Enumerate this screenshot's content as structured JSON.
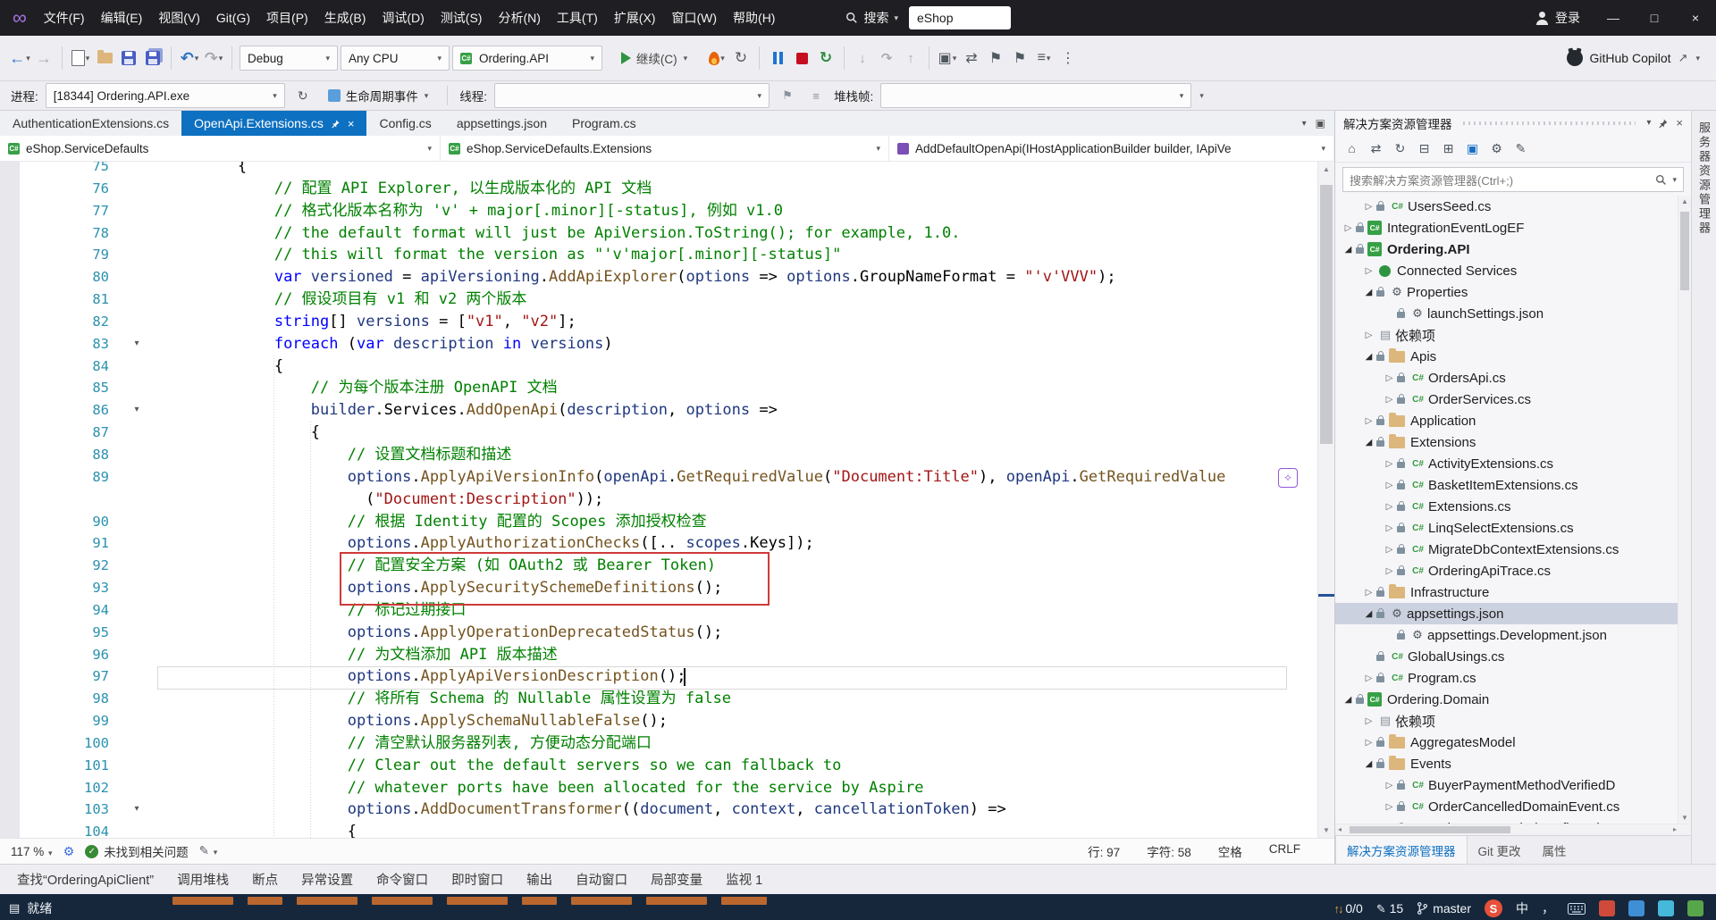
{
  "palette": {
    "accent_blue": "#0E70C0",
    "titlebar_bg": "#1F1F23",
    "toolbar_bg": "#EEEEF2",
    "statusbar_bg": "#16273C",
    "comment_green": "#008000",
    "keyword_blue": "#0000FF",
    "string_red": "#A31515",
    "method_brown": "#74531F",
    "identifier_blue": "#1F377F",
    "line_number_teal": "#2B91AF",
    "annotation_red": "#CF3A3A",
    "selection_gray": "#CCD1DF",
    "orange_marker": "#B9672E"
  },
  "icons": {
    "infinity": "∞",
    "chevron_down": "▾",
    "back": "←",
    "forward": "→",
    "undo": "↶",
    "redo": "↷",
    "refresh": "↻",
    "flag": "⚑",
    "min": "—",
    "max": "□",
    "close": "×",
    "check": "✓",
    "pencil": "✎",
    "up": "↑",
    "down": "↓",
    "gear": "⚙",
    "home": "⌂",
    "swap": "⇄",
    "collapse_all": "⊟",
    "show_all": "⊞",
    "grid": "▣",
    "deps": "▤",
    "dots": "⋮",
    "arrow_out": "↗",
    "tri_open": "◢",
    "tri_closed": "▷",
    "up_small": "▲",
    "down_small": "▼",
    "left_small": "◂",
    "right_small": "▸",
    "lines": "▤",
    "sparkle": "✧",
    "menu": "≡",
    "fold": "▾",
    "braces": "{}"
  },
  "titlebar": {
    "menus": [
      "文件(F)",
      "编辑(E)",
      "视图(V)",
      "Git(G)",
      "项目(P)",
      "生成(B)",
      "调试(D)",
      "测试(S)",
      "分析(N)",
      "工具(T)",
      "扩展(X)",
      "窗口(W)",
      "帮助(H)"
    ],
    "search_label": "搜索",
    "search_value": "eShop",
    "signin_label": "登录"
  },
  "toolbar": {
    "config": "Debug",
    "platform": "Any CPU",
    "profile": "Ordering.API",
    "continue_label": "继续(C)",
    "copilot_label": "GitHub Copilot"
  },
  "debugbar": {
    "process_label": "进程:",
    "process_value": "[18344] Ordering.API.exe",
    "lifecycle_label": "生命周期事件",
    "thread_label": "线程:",
    "stackframe_label": "堆栈帧:"
  },
  "tabbar": {
    "tabs": [
      {
        "label": "AuthenticationExtensions.cs",
        "active": false
      },
      {
        "label": "OpenApi.Extensions.cs",
        "active": true
      },
      {
        "label": "Config.cs",
        "active": false
      },
      {
        "label": "appsettings.json",
        "active": false
      },
      {
        "label": "Program.cs",
        "active": false
      }
    ]
  },
  "navbar": {
    "scopes": [
      {
        "label": "eShop.ServiceDefaults",
        "icon": "project"
      },
      {
        "label": "eShop.ServiceDefaults.Extensions",
        "icon": "class"
      },
      {
        "label": "AddDefaultOpenApi(IHostApplicationBuilder builder, IApiVe",
        "icon": "method"
      }
    ]
  },
  "editor": {
    "current_line": "97",
    "red_box_from": "92",
    "red_box_to": "93",
    "lines": [
      {
        "n": "75",
        "s": [
          [
            "p",
            "        {"
          ]
        ]
      },
      {
        "n": "76",
        "s": [
          [
            "p",
            "            "
          ],
          [
            "c",
            "// 配置 API Explorer, 以生成版本化的 API 文档"
          ]
        ]
      },
      {
        "n": "77",
        "s": [
          [
            "p",
            "            "
          ],
          [
            "c",
            "// 格式化版本名称为 'v' + major[.minor][-status], 例如 v1.0"
          ]
        ]
      },
      {
        "n": "78",
        "s": [
          [
            "p",
            "            "
          ],
          [
            "c",
            "// the default format will just be ApiVersion.ToString(); for example, 1.0."
          ]
        ]
      },
      {
        "n": "79",
        "s": [
          [
            "p",
            "            "
          ],
          [
            "c",
            "// this will format the version as \"'v'major[.minor][-status]\""
          ]
        ]
      },
      {
        "n": "80",
        "s": [
          [
            "p",
            "            "
          ],
          [
            "k",
            "var"
          ],
          [
            "p",
            " "
          ],
          [
            "v",
            "versioned"
          ],
          [
            "p",
            " = "
          ],
          [
            "v",
            "apiVersioning"
          ],
          [
            "p",
            "."
          ],
          [
            "m",
            "AddApiExplorer"
          ],
          [
            "p",
            "("
          ],
          [
            "v",
            "options"
          ],
          [
            "p",
            " => "
          ],
          [
            "v",
            "options"
          ],
          [
            "p",
            ".GroupNameFormat = "
          ],
          [
            "s",
            "\"'v'VVV\""
          ],
          [
            "p",
            ");"
          ]
        ]
      },
      {
        "n": "81",
        "s": [
          [
            "p",
            "            "
          ],
          [
            "c",
            "// 假设项目有 v1 和 v2 两个版本"
          ]
        ]
      },
      {
        "n": "82",
        "s": [
          [
            "p",
            "            "
          ],
          [
            "k",
            "string"
          ],
          [
            "p",
            "[] "
          ],
          [
            "v",
            "versions"
          ],
          [
            "p",
            " = ["
          ],
          [
            "s",
            "\"v1\""
          ],
          [
            "p",
            ", "
          ],
          [
            "s",
            "\"v2\""
          ],
          [
            "p",
            "];"
          ]
        ]
      },
      {
        "n": "83",
        "f": 1,
        "s": [
          [
            "p",
            "            "
          ],
          [
            "k",
            "foreach"
          ],
          [
            "p",
            " ("
          ],
          [
            "k",
            "var"
          ],
          [
            "p",
            " "
          ],
          [
            "v",
            "description"
          ],
          [
            "p",
            " "
          ],
          [
            "k",
            "in"
          ],
          [
            "p",
            " "
          ],
          [
            "v",
            "versions"
          ],
          [
            "p",
            ")"
          ]
        ]
      },
      {
        "n": "84",
        "s": [
          [
            "p",
            "            {"
          ]
        ]
      },
      {
        "n": "85",
        "s": [
          [
            "p",
            "                "
          ],
          [
            "c",
            "// 为每个版本注册 OpenAPI 文档"
          ]
        ]
      },
      {
        "n": "86",
        "f": 1,
        "s": [
          [
            "p",
            "                "
          ],
          [
            "v",
            "builder"
          ],
          [
            "p",
            ".Services."
          ],
          [
            "m",
            "AddOpenApi"
          ],
          [
            "p",
            "("
          ],
          [
            "v",
            "description"
          ],
          [
            "p",
            ", "
          ],
          [
            "v",
            "options"
          ],
          [
            "p",
            " =>"
          ]
        ]
      },
      {
        "n": "87",
        "s": [
          [
            "p",
            "                {"
          ]
        ]
      },
      {
        "n": "88",
        "s": [
          [
            "p",
            "                    "
          ],
          [
            "c",
            "// 设置文档标题和描述"
          ]
        ]
      },
      {
        "n": "89",
        "s": [
          [
            "p",
            "                    "
          ],
          [
            "v",
            "options"
          ],
          [
            "p",
            "."
          ],
          [
            "m",
            "ApplyApiVersionInfo"
          ],
          [
            "p",
            "("
          ],
          [
            "v",
            "openApi"
          ],
          [
            "p",
            "."
          ],
          [
            "m",
            "GetRequiredValue"
          ],
          [
            "p",
            "("
          ],
          [
            "s",
            "\"Document:Title\""
          ],
          [
            "p",
            "), "
          ],
          [
            "v",
            "openApi"
          ],
          [
            "p",
            "."
          ],
          [
            "m",
            "GetRequiredValue"
          ]
        ]
      },
      {
        "n": "",
        "s": [
          [
            "p",
            "                      ("
          ],
          [
            "s",
            "\"Document:Description\""
          ],
          [
            "p",
            "));"
          ]
        ]
      },
      {
        "n": "90",
        "s": [
          [
            "p",
            "                    "
          ],
          [
            "c",
            "// 根据 Identity 配置的 Scopes 添加授权检查"
          ]
        ]
      },
      {
        "n": "91",
        "s": [
          [
            "p",
            "                    "
          ],
          [
            "v",
            "options"
          ],
          [
            "p",
            "."
          ],
          [
            "m",
            "ApplyAuthorizationChecks"
          ],
          [
            "p",
            "([.. "
          ],
          [
            "v",
            "scopes"
          ],
          [
            "p",
            ".Keys]);"
          ]
        ]
      },
      {
        "n": "92",
        "s": [
          [
            "p",
            "                    "
          ],
          [
            "c",
            "// 配置安全方案 (如 OAuth2 或 Bearer Token)"
          ]
        ]
      },
      {
        "n": "93",
        "s": [
          [
            "p",
            "                    "
          ],
          [
            "v",
            "options"
          ],
          [
            "p",
            "."
          ],
          [
            "m",
            "ApplySecuritySchemeDefinitions"
          ],
          [
            "p",
            "();"
          ]
        ]
      },
      {
        "n": "94",
        "s": [
          [
            "p",
            "                    "
          ],
          [
            "c",
            "// 标记过期接口"
          ]
        ]
      },
      {
        "n": "95",
        "s": [
          [
            "p",
            "                    "
          ],
          [
            "v",
            "options"
          ],
          [
            "p",
            "."
          ],
          [
            "m",
            "ApplyOperationDeprecatedStatus"
          ],
          [
            "p",
            "();"
          ]
        ]
      },
      {
        "n": "96",
        "s": [
          [
            "p",
            "                    "
          ],
          [
            "c",
            "// 为文档添加 API 版本描述"
          ]
        ]
      },
      {
        "n": "97",
        "s": [
          [
            "p",
            "                    "
          ],
          [
            "v",
            "options"
          ],
          [
            "p",
            "."
          ],
          [
            "m",
            "ApplyApiVersionDescription"
          ],
          [
            "p",
            "();"
          ]
        ]
      },
      {
        "n": "98",
        "s": [
          [
            "p",
            "                    "
          ],
          [
            "c",
            "// 将所有 Schema 的 Nullable 属性设置为 false"
          ]
        ]
      },
      {
        "n": "99",
        "s": [
          [
            "p",
            "                    "
          ],
          [
            "v",
            "options"
          ],
          [
            "p",
            "."
          ],
          [
            "m",
            "ApplySchemaNullableFalse"
          ],
          [
            "p",
            "();"
          ]
        ]
      },
      {
        "n": "100",
        "s": [
          [
            "p",
            "                    "
          ],
          [
            "c",
            "// 清空默认服务器列表, 方便动态分配端口"
          ]
        ]
      },
      {
        "n": "101",
        "s": [
          [
            "p",
            "                    "
          ],
          [
            "c",
            "// Clear out the default servers so we can fallback to"
          ]
        ]
      },
      {
        "n": "102",
        "s": [
          [
            "p",
            "                    "
          ],
          [
            "c",
            "// whatever ports have been allocated for the service by Aspire"
          ]
        ]
      },
      {
        "n": "103",
        "f": 1,
        "s": [
          [
            "p",
            "                    "
          ],
          [
            "v",
            "options"
          ],
          [
            "p",
            "."
          ],
          [
            "m",
            "AddDocumentTransformer"
          ],
          [
            "p",
            "(("
          ],
          [
            "v",
            "document"
          ],
          [
            "p",
            ", "
          ],
          [
            "v",
            "context"
          ],
          [
            "p",
            ", "
          ],
          [
            "v",
            "cancellationToken"
          ],
          [
            "p",
            ") =>"
          ]
        ]
      },
      {
        "n": "104",
        "s": [
          [
            "p",
            "                    {"
          ]
        ]
      }
    ]
  },
  "editor_status": {
    "zoom": "117 %",
    "health": "未找到相关问题",
    "line": "行: 97",
    "column": "字符: 58",
    "whitespace": "空格",
    "line_ending": "CRLF"
  },
  "solution_explorer": {
    "title": "解决方案资源管理器",
    "search_placeholder": "搜索解决方案资源管理器(Ctrl+;)",
    "items": [
      {
        "lv": 2,
        "ex": "c",
        "ic": "cs",
        "lock": 1,
        "label": "UsersSeed.cs"
      },
      {
        "lv": 1,
        "ex": "c",
        "ic": "proj",
        "lock": 1,
        "label": "IntegrationEventLogEF"
      },
      {
        "lv": 1,
        "ex": "o",
        "ic": "proj",
        "lock": 1,
        "label": "Ordering.API",
        "bold": 1
      },
      {
        "lv": 2,
        "ex": "c",
        "ic": "plug",
        "lock": 0,
        "label": "Connected Services"
      },
      {
        "lv": 2,
        "ex": "o",
        "ic": "props",
        "lock": 1,
        "label": "Properties"
      },
      {
        "lv": 3,
        "ex": "n",
        "ic": "json",
        "lock": 1,
        "label": "launchSettings.json"
      },
      {
        "lv": 2,
        "ex": "c",
        "ic": "deps",
        "lock": 0,
        "label": "依赖项"
      },
      {
        "lv": 2,
        "ex": "o",
        "ic": "folder",
        "lock": 1,
        "label": "Apis"
      },
      {
        "lv": 3,
        "ex": "c",
        "ic": "cs",
        "lock": 1,
        "label": "OrdersApi.cs"
      },
      {
        "lv": 3,
        "ex": "c",
        "ic": "cs",
        "lock": 1,
        "label": "OrderServices.cs"
      },
      {
        "lv": 2,
        "ex": "c",
        "ic": "folder",
        "lock": 1,
        "label": "Application"
      },
      {
        "lv": 2,
        "ex": "o",
        "ic": "folder",
        "lock": 1,
        "label": "Extensions"
      },
      {
        "lv": 3,
        "ex": "c",
        "ic": "cs",
        "lock": 1,
        "label": "ActivityExtensions.cs"
      },
      {
        "lv": 3,
        "ex": "c",
        "ic": "cs",
        "lock": 1,
        "label": "BasketItemExtensions.cs"
      },
      {
        "lv": 3,
        "ex": "c",
        "ic": "cs",
        "lock": 1,
        "label": "Extensions.cs"
      },
      {
        "lv": 3,
        "ex": "c",
        "ic": "cs",
        "lock": 1,
        "label": "LinqSelectExtensions.cs"
      },
      {
        "lv": 3,
        "ex": "c",
        "ic": "cs",
        "lock": 1,
        "label": "MigrateDbContextExtensions.cs"
      },
      {
        "lv": 3,
        "ex": "c",
        "ic": "cs",
        "lock": 1,
        "label": "OrderingApiTrace.cs"
      },
      {
        "lv": 2,
        "ex": "c",
        "ic": "folder",
        "lock": 1,
        "label": "Infrastructure"
      },
      {
        "lv": 2,
        "ex": "o",
        "ic": "json",
        "lock": 1,
        "label": "appsettings.json",
        "sel": 1
      },
      {
        "lv": 3,
        "ex": "n",
        "ic": "json",
        "lock": 1,
        "label": "appsettings.Development.json"
      },
      {
        "lv": 2,
        "ex": "n",
        "ic": "cs",
        "lock": 1,
        "label": "GlobalUsings.cs"
      },
      {
        "lv": 2,
        "ex": "c",
        "ic": "cs",
        "lock": 1,
        "label": "Program.cs"
      },
      {
        "lv": 1,
        "ex": "o",
        "ic": "proj",
        "lock": 1,
        "label": "Ordering.Domain"
      },
      {
        "lv": 2,
        "ex": "c",
        "ic": "deps",
        "lock": 0,
        "label": "依赖项"
      },
      {
        "lv": 2,
        "ex": "c",
        "ic": "folder",
        "lock": 1,
        "label": "AggregatesModel"
      },
      {
        "lv": 2,
        "ex": "o",
        "ic": "folder",
        "lock": 1,
        "label": "Events"
      },
      {
        "lv": 3,
        "ex": "c",
        "ic": "cs",
        "lock": 1,
        "label": "BuyerPaymentMethodVerifiedD"
      },
      {
        "lv": 3,
        "ex": "c",
        "ic": "cs",
        "lock": 1,
        "label": "OrderCancelledDomainEvent.cs"
      },
      {
        "lv": 3,
        "ex": "c",
        "ic": "cs",
        "lock": 1,
        "label": "OrderGracePeriodConfirmedDo"
      }
    ],
    "bottom_tabs": [
      {
        "label": "解决方案资源管理器",
        "active": true
      },
      {
        "label": "Git 更改",
        "active": false
      },
      {
        "label": "属性",
        "active": false
      }
    ]
  },
  "bottom_panel_tabs": [
    "查找“OrderingApiClient”",
    "调用堆栈",
    "断点",
    "异常设置",
    "命令窗口",
    "即时窗口",
    "输出",
    "自动窗口",
    "局部变量",
    "监视 1"
  ],
  "statusbar": {
    "ready": "就绪",
    "nav_counter": "0/0",
    "edit_count": "15",
    "branch": "master",
    "ime_logo": "S",
    "ime_mode": "中",
    "ime_punct": "，"
  },
  "right_strip": {
    "label": "服务器资源管理器"
  }
}
